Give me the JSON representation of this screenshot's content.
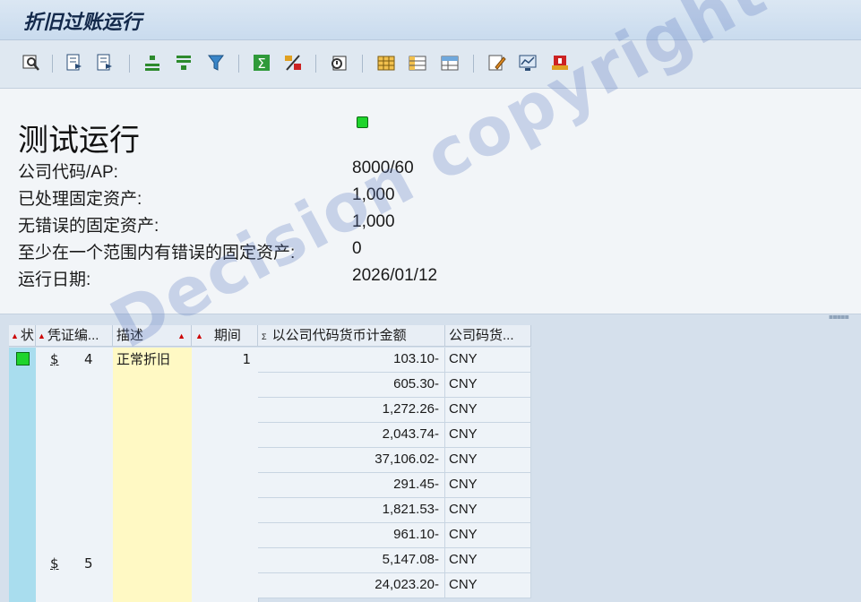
{
  "window": {
    "title": "折旧过账运行"
  },
  "toolbar": {
    "buttons": [
      {
        "name": "details-icon"
      },
      {
        "name": "first-page-icon"
      },
      {
        "name": "last-page-icon"
      },
      {
        "name": "sort-ascending-icon"
      },
      {
        "name": "sort-descending-icon"
      },
      {
        "name": "filter-icon"
      },
      {
        "name": "sum-icon"
      },
      {
        "name": "subtotal-icon"
      },
      {
        "name": "print-preview-icon"
      },
      {
        "name": "spreadsheet-icon"
      },
      {
        "name": "change-layout-icon"
      },
      {
        "name": "select-layout-icon"
      },
      {
        "name": "save-layout-icon"
      },
      {
        "name": "graphic-icon"
      },
      {
        "name": "info-icon"
      }
    ]
  },
  "summary": {
    "heading": "测试运行",
    "status_color": "#1fd42c",
    "rows": [
      {
        "label": "公司代码/AP:",
        "value": "8000/60"
      },
      {
        "label": "已处理固定资产:",
        "value": "1,000"
      },
      {
        "label": "无错误的固定资产:",
        "value": "1,000"
      },
      {
        "label": "至少在一个范围内有错误的固定资产:",
        "value": "0"
      },
      {
        "label": "运行日期:",
        "value": "2026/01/12"
      }
    ]
  },
  "watermark": "Decision copyright",
  "grid": {
    "headers": {
      "status": "状",
      "doc": "凭证编...",
      "desc": "描述",
      "period": "期间",
      "amount": "以公司代码货币计金额",
      "currency": "公司码货..."
    },
    "group1": {
      "doc_currency_symbol": "$",
      "doc_number": "4",
      "description": "正常折旧",
      "period": "1"
    },
    "group2": {
      "doc_currency_symbol": "$",
      "doc_number": "5"
    },
    "rows": [
      {
        "amount": "103.10-",
        "currency": "CNY"
      },
      {
        "amount": "605.30-",
        "currency": "CNY"
      },
      {
        "amount": "1,272.26-",
        "currency": "CNY"
      },
      {
        "amount": "2,043.74-",
        "currency": "CNY"
      },
      {
        "amount": "37,106.02-",
        "currency": "CNY"
      },
      {
        "amount": "291.45-",
        "currency": "CNY"
      },
      {
        "amount": "1,821.53-",
        "currency": "CNY"
      },
      {
        "amount": "961.10-",
        "currency": "CNY"
      },
      {
        "amount": "5,147.08-",
        "currency": "CNY"
      },
      {
        "amount": "24,023.20-",
        "currency": "CNY"
      }
    ]
  }
}
